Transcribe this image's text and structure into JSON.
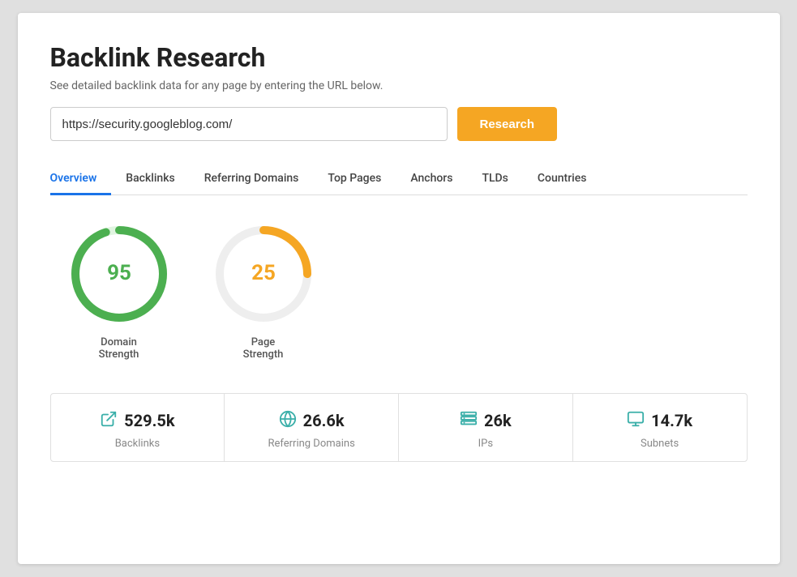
{
  "page": {
    "title": "Backlink Research",
    "subtitle": "See detailed backlink data for any page by entering the URL below.",
    "url_input_value": "https://security.googleblog.com/",
    "url_input_placeholder": "https://security.googleblog.com/",
    "research_button_label": "Research"
  },
  "tabs": [
    {
      "id": "overview",
      "label": "Overview",
      "active": true
    },
    {
      "id": "backlinks",
      "label": "Backlinks",
      "active": false
    },
    {
      "id": "referring-domains",
      "label": "Referring Domains",
      "active": false
    },
    {
      "id": "top-pages",
      "label": "Top Pages",
      "active": false
    },
    {
      "id": "anchors",
      "label": "Anchors",
      "active": false
    },
    {
      "id": "tlds",
      "label": "TLDs",
      "active": false
    },
    {
      "id": "countries",
      "label": "Countries",
      "active": false
    }
  ],
  "gauges": [
    {
      "id": "domain-strength",
      "value": 95,
      "label": "Domain\nStrength",
      "label_line1": "Domain",
      "label_line2": "Strength",
      "color": "#4caf50",
      "bg_color": "#e0f5e0",
      "percent": 95
    },
    {
      "id": "page-strength",
      "value": 25,
      "label": "Page\nStrength",
      "label_line1": "Page",
      "label_line2": "Strength",
      "color": "#f5a623",
      "bg_color": "#eeeeee",
      "percent": 25
    }
  ],
  "stats": [
    {
      "id": "backlinks",
      "value": "529.5k",
      "label": "Backlinks",
      "icon": "backlinks-icon"
    },
    {
      "id": "referring-domains",
      "value": "26.6k",
      "label": "Referring Domains",
      "icon": "globe-icon"
    },
    {
      "id": "ips",
      "value": "26k",
      "label": "IPs",
      "icon": "ips-icon"
    },
    {
      "id": "subnets",
      "value": "14.7k",
      "label": "Subnets",
      "icon": "subnets-icon"
    }
  ]
}
